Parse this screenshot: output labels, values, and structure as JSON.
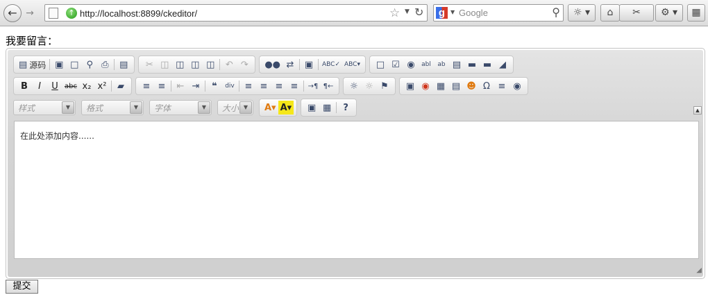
{
  "browser": {
    "back_icon": "arrow-left-icon",
    "forward_icon": "arrow-right-icon",
    "url": "http://localhost:8899/ckeditor/",
    "search_placeholder": "Google",
    "icons": [
      "page-icon",
      "globe-icon",
      "star-icon",
      "reload-icon",
      "google-icon",
      "magnifier-icon",
      "home-icon",
      "addon-icon",
      "windows-icon"
    ]
  },
  "page": {
    "label": "我要留言：",
    "submit_label": "提交"
  },
  "editor": {
    "source_label": "源码",
    "combos": {
      "style": "样式",
      "format": "格式",
      "font": "字体",
      "size": "大小"
    },
    "content_text": "在此处添加内容......",
    "toolbar_icons": {
      "row1": [
        "source",
        "save",
        "new-page",
        "preview",
        "print",
        "templates",
        "cut",
        "copy",
        "paste",
        "paste-text",
        "paste-word",
        "undo",
        "redo",
        "find",
        "replace",
        "select-all",
        "spellcheck",
        "scayt",
        "form",
        "checkbox",
        "radio",
        "textfield",
        "textarea",
        "select",
        "button",
        "imagebutton",
        "hiddenfield"
      ],
      "row2": [
        "bold",
        "italic",
        "underline",
        "strike",
        "subscript",
        "superscript",
        "remove-format",
        "numbered-list",
        "bulleted-list",
        "outdent",
        "indent",
        "blockquote",
        "creatediv",
        "align-left",
        "align-center",
        "align-right",
        "justify",
        "bidi-ltr",
        "bidi-rtl",
        "link",
        "unlink",
        "anchor",
        "image",
        "flash",
        "table",
        "horizontal-rule",
        "smiley",
        "special-char",
        "page-break",
        "iframe"
      ],
      "row3": [
        "text-color",
        "bg-color",
        "maximize",
        "show-blocks",
        "about"
      ]
    }
  },
  "colors": {
    "toolbar_bg": "#d4d4d4",
    "accent_blue": "#3a4a6a"
  }
}
